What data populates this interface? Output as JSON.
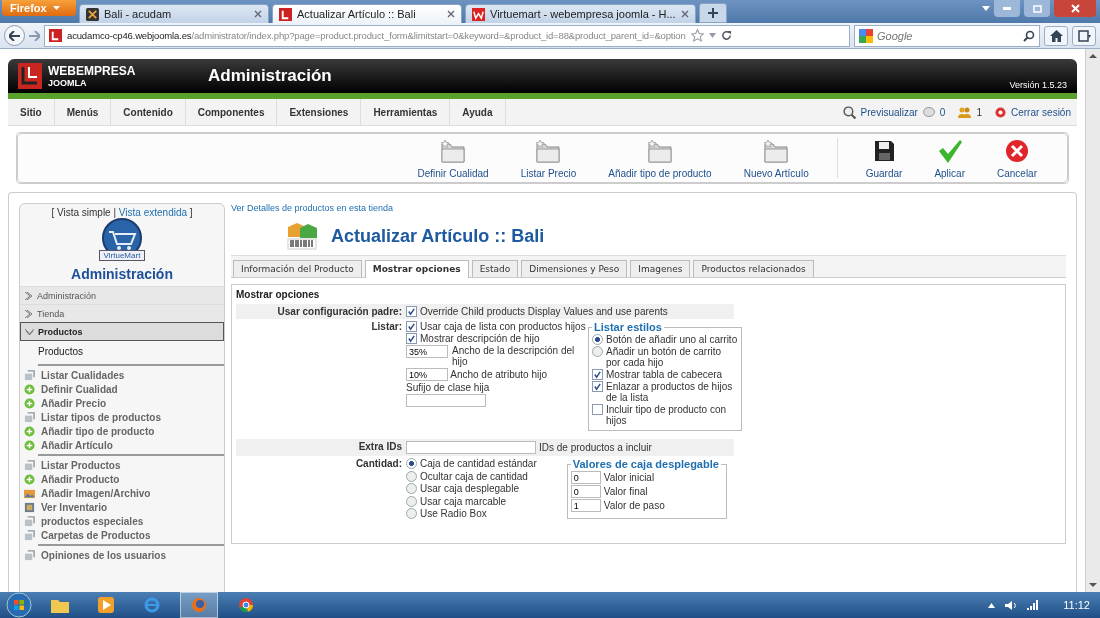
{
  "browser": {
    "menu_button": "Firefox",
    "tabs": [
      {
        "title": "Bali - acudam",
        "selected": false,
        "kind": "dark"
      },
      {
        "title": "Actualizar Artículo :: Bali",
        "selected": true,
        "kind": "joomla"
      },
      {
        "title": "Virtuemart - webempresa joomla - H...",
        "selected": false,
        "kind": "web"
      }
    ],
    "url_host": "acudamco-cp46.webjoomla.es",
    "url_path": "/administrator/index.php?page=product.product_form&limitstart=0&keyword=&product_id=88&product_parent_id=&option",
    "search": {
      "placeholder": "Google"
    }
  },
  "header": {
    "brand": "WEBEMPRESA",
    "brand_sub": "JOOMLA",
    "title": "Administración",
    "version": "Versión 1.5.23"
  },
  "menu": {
    "items": [
      "Sitio",
      "Menús",
      "Contenido",
      "Componentes",
      "Extensiones",
      "Herramientas",
      "Ayuda"
    ],
    "preview": "Previsualizar",
    "messages": "0",
    "users": "1",
    "logout": "Cerrar sesión"
  },
  "toolbar": [
    {
      "label": "Definir Cualidad",
      "kind": "folder"
    },
    {
      "label": "Listar Precio",
      "kind": "folder"
    },
    {
      "label": "Añadir tipo de producto",
      "kind": "folder"
    },
    {
      "label": "Nuevo Artículo",
      "kind": "folder"
    },
    {
      "label": "Guardar",
      "kind": "save"
    },
    {
      "label": "Aplicar",
      "kind": "apply"
    },
    {
      "label": "Cancelar",
      "kind": "cancel"
    }
  ],
  "sidebar": {
    "view_open": "[",
    "view_current": "Vista simple",
    "view_separator": "|",
    "view_link": "Vista extendida",
    "view_close": "]",
    "logo_text": "VirtueMart",
    "title": "Administración",
    "sections": [
      {
        "label": "Administración",
        "expanded": false
      },
      {
        "label": "Tienda",
        "expanded": false
      },
      {
        "label": "Productos",
        "expanded": true
      }
    ],
    "heading": "Productos",
    "groups": [
      [
        {
          "label": "Listar Cualidades",
          "kind": "list"
        },
        {
          "label": "Definir Cualidad",
          "kind": "add"
        },
        {
          "label": "Añadir Precio",
          "kind": "add"
        },
        {
          "label": "Listar tipos de productos",
          "kind": "list"
        },
        {
          "label": "Añadir tipo de producto",
          "kind": "add"
        },
        {
          "label": "Añadir Artículo",
          "kind": "add"
        }
      ],
      [
        {
          "label": "Listar Productos",
          "kind": "list"
        },
        {
          "label": "Añadir Producto",
          "kind": "add"
        },
        {
          "label": "Añadir Imagen/Archivo",
          "kind": "image"
        },
        {
          "label": "Ver Inventario",
          "kind": "inventory"
        },
        {
          "label": "productos especiales",
          "kind": "list"
        },
        {
          "label": "Carpetas de Productos",
          "kind": "list"
        }
      ],
      [
        {
          "label": "Opiniones de los usuarios",
          "kind": "list"
        }
      ]
    ]
  },
  "main": {
    "details_link": "Ver Detalles de productos en esta tienda",
    "title": "Actualizar Artículo :: Bali",
    "tabs": [
      {
        "label": "Información del Producto",
        "selected": false
      },
      {
        "label": "Mostrar opciones",
        "selected": true
      },
      {
        "label": "Estado",
        "selected": false
      },
      {
        "label": "Dimensiones y Peso",
        "selected": false
      },
      {
        "label": "Imagenes",
        "selected": false
      },
      {
        "label": "Productos relacionados",
        "selected": false
      }
    ],
    "section_title": "Mostrar opciones",
    "parent_config": {
      "label": "Usar configuración padre:",
      "checked": true,
      "text": "Override Child products Display Values and use parents"
    },
    "list": {
      "label": "Listar:",
      "checks": [
        {
          "label": "Usar caja de lista con productos hijos",
          "checked": true
        },
        {
          "label": "Mostrar descripción de hijo",
          "checked": true
        }
      ],
      "desc_width": {
        "value": "35%",
        "label": "Ancho de la descripción del hijo"
      },
      "attr_width": {
        "value": "10%",
        "label": "Ancho de atributo hijo"
      },
      "suffix_label": "Sufijo de clase hija",
      "styles": {
        "legend": "Listar estilos",
        "options": [
          {
            "kind": "radio",
            "label": "Botón de añadir uno al carrito",
            "selected": true
          },
          {
            "kind": "radio",
            "label": "Añadir un botón de carrito por cada hijo",
            "selected": false
          },
          {
            "kind": "checkbox",
            "label": "Mostrar tabla de cabecera",
            "checked": true
          },
          {
            "kind": "checkbox",
            "label": "Enlazar a productos de hijos de la lista",
            "checked": true
          },
          {
            "kind": "checkbox",
            "label": "Incluir tipo de producto con hijos",
            "checked": false
          }
        ]
      }
    },
    "extra_ids": {
      "label": "Extra IDs",
      "hint": "IDs de productos a incluir"
    },
    "quantity": {
      "label": "Cantidad:",
      "options": [
        {
          "label": "Caja de cantidad estándar",
          "selected": true
        },
        {
          "label": "Ocultar caja de cantidad",
          "selected": false
        },
        {
          "label": "Usar caja desplegable",
          "selected": false
        },
        {
          "label": "Usar caja marcable",
          "selected": false
        },
        {
          "label": "Use Radio Box",
          "selected": false
        }
      ],
      "dropdown": {
        "legend": "Valores de caja desplegable",
        "fields": [
          {
            "value": "0",
            "label": "Valor inicial"
          },
          {
            "value": "0",
            "label": "Valor final"
          },
          {
            "value": "1",
            "label": "Valor de paso"
          }
        ]
      }
    }
  },
  "taskbar": {
    "clock": "11:12"
  }
}
